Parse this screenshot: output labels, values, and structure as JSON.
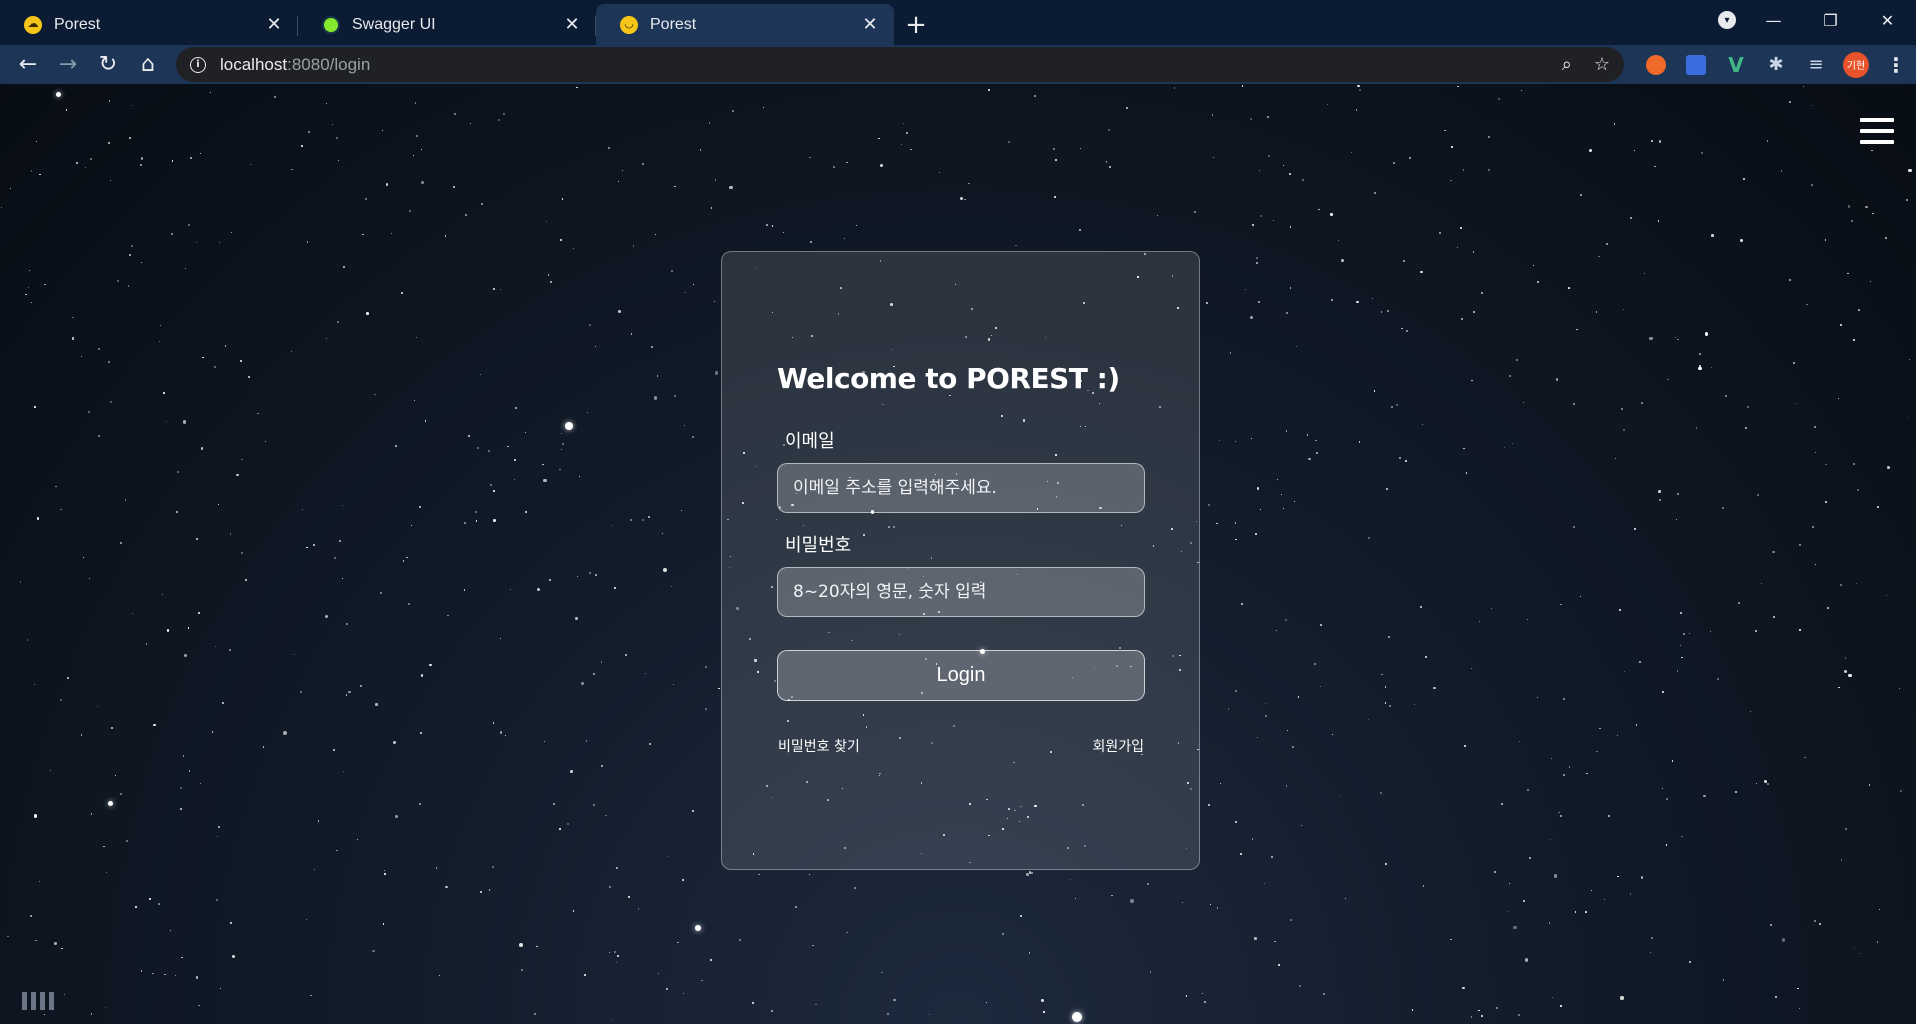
{
  "browser": {
    "tabs": [
      {
        "title": "Porest",
        "favicon": "porest-cloud-icon",
        "close": "✕"
      },
      {
        "title": "Swagger UI",
        "favicon": "swagger-icon",
        "close": "✕"
      },
      {
        "title": "Porest",
        "favicon": "porest-face-icon",
        "close": "✕",
        "active": true
      }
    ],
    "new_tab_glyph": "+",
    "window_controls": {
      "minimize": "—",
      "restore": "❐",
      "close": "✕"
    },
    "url_host": "localhost",
    "url_rest": ":8080/login",
    "profile_initials": "기현"
  },
  "page": {
    "card_title": "Welcome to POREST :)",
    "email_label": "이메일",
    "email_placeholder": "이메일 주소를 입력해주세요.",
    "email_value": "",
    "password_label": "비밀번호",
    "password_placeholder": "8~20자의 영문, 숫자 입력",
    "password_value": "",
    "login_button": "Login",
    "find_password_link": "비밀번호 찾기",
    "signup_link": "회원가입"
  },
  "colors": {
    "tabstrip_bg": "#0b1b34",
    "toolbar_bg": "#1d3557",
    "page_bg": "#111b29",
    "card_text": "#ffffff"
  }
}
